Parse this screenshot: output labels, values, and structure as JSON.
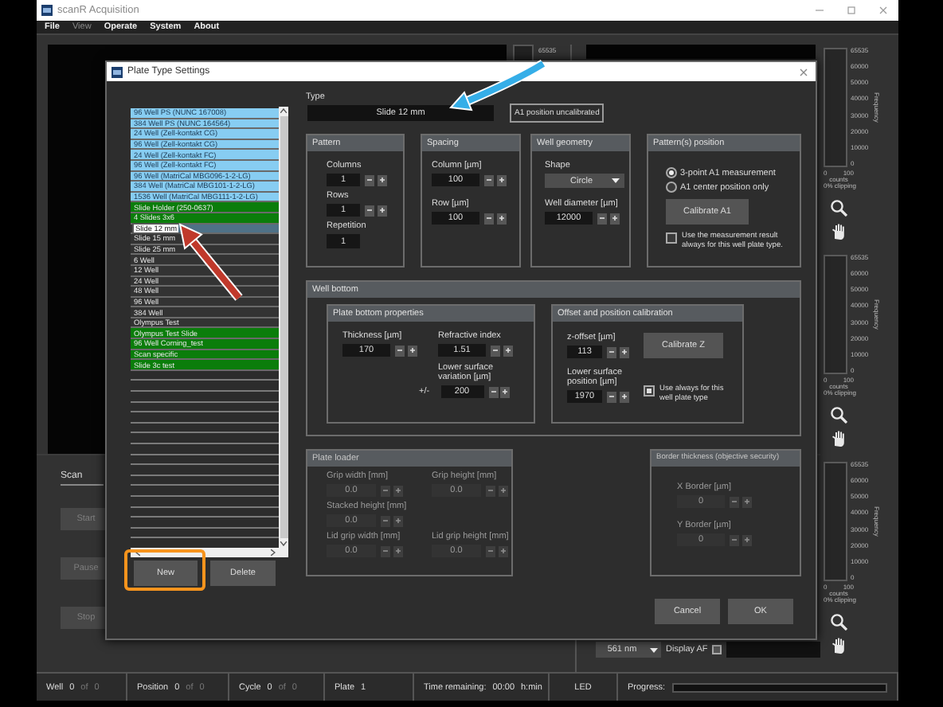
{
  "app": {
    "title": "scanR Acquisition",
    "menu": [
      {
        "label": "File",
        "disabled": false
      },
      {
        "label": "View",
        "disabled": true
      },
      {
        "label": "Operate",
        "disabled": false
      },
      {
        "label": "System",
        "disabled": false
      },
      {
        "label": "About",
        "disabled": false
      }
    ]
  },
  "preview": {
    "max_tick": "65535"
  },
  "histograms": [
    {
      "ticks": [
        "65535",
        "60000",
        "50000",
        "40000",
        "30000",
        "20000",
        "10000",
        "0"
      ],
      "axis_label": "Frequency",
      "x_min": "0",
      "x_max": "100",
      "x_label": "counts",
      "clipping": "0% clipping"
    },
    {
      "ticks": [
        "65535",
        "60000",
        "50000",
        "40000",
        "30000",
        "20000",
        "10000",
        "0"
      ],
      "axis_label": "Frequency",
      "x_min": "0",
      "x_max": "100",
      "x_label": "counts",
      "clipping": "0% clipping"
    },
    {
      "ticks": [
        "65535",
        "60000",
        "50000",
        "40000",
        "30000",
        "20000",
        "10000",
        "0"
      ],
      "axis_label": "Frequency",
      "x_min": "0",
      "x_max": "100",
      "x_label": "counts",
      "clipping": "0% clipping"
    }
  ],
  "scan": {
    "tab": "Scan",
    "buttons": [
      {
        "label": "Start",
        "disabled": true
      },
      {
        "label": "Pause",
        "disabled": true
      },
      {
        "label": "Stop",
        "disabled": true
      }
    ]
  },
  "display": {
    "wavelength": "561 nm",
    "af_label": "Display AF",
    "af_checked": false
  },
  "status_bar": [
    {
      "kind": "counter",
      "label": "Well",
      "value": "0",
      "of": "of",
      "total": "0"
    },
    {
      "kind": "counter",
      "label": "Position",
      "value": "0",
      "of": "of",
      "total": "0"
    },
    {
      "kind": "counter",
      "label": "Cycle",
      "value": "0",
      "of": "of",
      "total": "0"
    },
    {
      "kind": "value",
      "label": "Plate",
      "value": "1"
    },
    {
      "kind": "timer",
      "label": "Time remaining:",
      "value": "00:00",
      "unit": "h:min"
    },
    {
      "kind": "indicator",
      "label": "LED"
    },
    {
      "kind": "progress",
      "label": "Progress:",
      "level": 0
    }
  ],
  "dialog": {
    "title": "Plate Type Settings",
    "plate_types": [
      {
        "label": "96 Well PS (NUNC 167008)",
        "color": "#87cdf2",
        "selected": false
      },
      {
        "label": "384 Well PS (NUNC 164564)",
        "color": "#87cdf2",
        "selected": false
      },
      {
        "label": "24 Well (Zell-kontakt CG)",
        "color": "#87cdf2",
        "selected": false
      },
      {
        "label": "96 Well (Zell-kontakt CG)",
        "color": "#87cdf2",
        "selected": false
      },
      {
        "label": "24 Well (Zell-kontakt FC)",
        "color": "#87cdf2",
        "selected": false
      },
      {
        "label": "96 Well (Zell-kontakt FC)",
        "color": "#87cdf2",
        "selected": false
      },
      {
        "label": "96 Well (MatriCal MBG096-1-2-LG)",
        "color": "#87cdf2",
        "selected": false
      },
      {
        "label": "384 Well (MatriCal MBG101-1-2-LG)",
        "color": "#87cdf2",
        "selected": false
      },
      {
        "label": "1536 Well (MatriCal MBG111-1-2-LG)",
        "color": "#87cdf2",
        "selected": false
      },
      {
        "label": "Slide Holder (250-0637)",
        "color": "#0b7d0b",
        "selected": false
      },
      {
        "label": "4 Slides 3x6",
        "color": "#0b7d0b",
        "selected": false
      },
      {
        "label": "Slide 12 mm",
        "color": "#333333",
        "selected": true
      },
      {
        "label": "Slide 15 mm",
        "color": "#333333",
        "selected": false
      },
      {
        "label": "Slide 25 mm",
        "color": "#333333",
        "selected": false
      },
      {
        "label": "6 Well",
        "color": "#333333",
        "selected": false
      },
      {
        "label": "12 Well",
        "color": "#333333",
        "selected": false
      },
      {
        "label": "24 Well",
        "color": "#333333",
        "selected": false
      },
      {
        "label": "48 Well",
        "color": "#333333",
        "selected": false
      },
      {
        "label": "96 Well",
        "color": "#333333",
        "selected": false
      },
      {
        "label": "384 Well",
        "color": "#333333",
        "selected": false
      },
      {
        "label": "Olympus Test",
        "color": "#333333",
        "selected": false
      },
      {
        "label": "Olympus Test Slide",
        "color": "#0b7d0b",
        "selected": false
      },
      {
        "label": "96 Well Corning_test",
        "color": "#0b7d0b",
        "selected": false
      },
      {
        "label": "Scan specific",
        "color": "#0b7d0b",
        "selected": false
      },
      {
        "label": "Slide 3c test",
        "color": "#0b7d0b",
        "selected": false
      }
    ],
    "list_buttons": [
      "New",
      "Delete"
    ],
    "type": {
      "label": "Type",
      "value": "Slide 12 mm",
      "status": "A1 position uncalibrated"
    },
    "pattern": {
      "title": "Pattern",
      "fields": [
        {
          "label": "Columns",
          "value": "1",
          "kind": "spin"
        },
        {
          "label": "Rows",
          "value": "1",
          "kind": "spin"
        },
        {
          "label": "Repetition",
          "value": "1",
          "kind": "plain"
        }
      ]
    },
    "spacing": {
      "title": "Spacing",
      "fields": [
        {
          "label": "Column [µm]",
          "value": "100",
          "kind": "spin"
        },
        {
          "label": "Row [µm]",
          "value": "100",
          "kind": "spin"
        }
      ]
    },
    "well_geometry": {
      "title": "Well geometry",
      "fields": [
        {
          "label": "Shape",
          "value": "Circle",
          "kind": "dropdown"
        },
        {
          "label": "Well diameter [µm]",
          "value": "12000",
          "kind": "spin"
        }
      ]
    },
    "patterns_position": {
      "title": "Pattern(s) position",
      "options": [
        {
          "label": "3-point A1 measurement",
          "selected": true
        },
        {
          "label": "A1 center position only",
          "selected": false
        }
      ],
      "button": "Calibrate A1",
      "checkbox": {
        "label": "Use the measurement result always for this well plate type.",
        "checked": false
      }
    },
    "well_bottom": {
      "title": "Well bottom",
      "plate_bottom": {
        "title": "Plate bottom properties",
        "fields": [
          {
            "label": "Thickness [µm]",
            "value": "170",
            "kind": "spin"
          },
          {
            "label": "Refractive index",
            "value": "1.51",
            "kind": "spin"
          },
          {
            "label": "Lower surface variation [µm]",
            "value": "200",
            "kind": "spin",
            "prefix": "+/-"
          }
        ]
      },
      "offset": {
        "title": "Offset and position calibration",
        "fields": [
          {
            "label": "z-offset [µm]",
            "value": "113",
            "kind": "spin"
          },
          {
            "label": "Lower surface position [µm]",
            "value": "1970",
            "kind": "spin"
          }
        ],
        "button": "Calibrate Z",
        "checkbox": {
          "label": "Use always for this well plate type",
          "checked": true
        }
      }
    },
    "plate_loader": {
      "title": "Plate loader",
      "disabled": true,
      "fields": [
        {
          "label": "Grip width [mm]",
          "value": "0.0",
          "kind": "spin"
        },
        {
          "label": "Grip height [mm]",
          "value": "0.0",
          "kind": "spin"
        },
        {
          "label": "Stacked height [mm]",
          "value": "0.0",
          "kind": "spin"
        },
        {
          "label": "Lid grip width [mm]",
          "value": "0.0",
          "kind": "spin"
        },
        {
          "label": "Lid grip height [mm]",
          "value": "0.0",
          "kind": "spin"
        }
      ]
    },
    "border_thickness": {
      "title": "Border thickness (objective security)",
      "disabled": true,
      "fields": [
        {
          "label": "X Border [µm]",
          "value": "0",
          "kind": "spin"
        },
        {
          "label": "Y Border [µm]",
          "value": "0",
          "kind": "spin"
        }
      ]
    },
    "buttons": [
      "Cancel",
      "OK"
    ]
  },
  "annotations": [
    {
      "kind": "arrow",
      "color": "#35aee8"
    },
    {
      "kind": "arrow",
      "color": "#c0392b"
    },
    {
      "kind": "frame",
      "color": "#f7941d"
    }
  ]
}
